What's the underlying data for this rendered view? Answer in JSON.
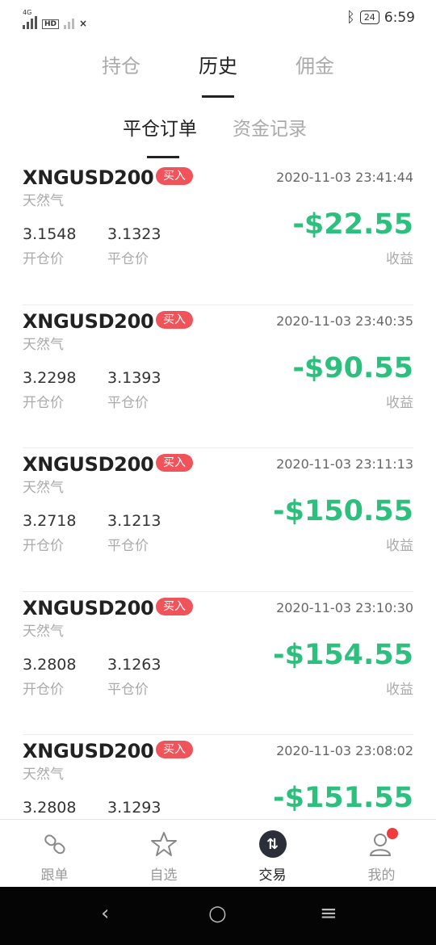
{
  "status_bar": {
    "network": "4G",
    "hd": "HD",
    "x": "×",
    "battery": "24",
    "time": "6:59"
  },
  "tabs": [
    {
      "label": "持仓"
    },
    {
      "label": "历史"
    },
    {
      "label": "佣金"
    }
  ],
  "subtabs": [
    {
      "label": "平仓订单"
    },
    {
      "label": "资金记录"
    }
  ],
  "labels": {
    "open_price": "开仓价",
    "close_price": "平仓价",
    "profit": "收益"
  },
  "orders": [
    {
      "symbol": "XNGUSD200",
      "side": "买入",
      "time": "2020-11-03 23:41:44",
      "name": "天然气",
      "open_price": "3.1548",
      "close_price": "3.1323",
      "pnl": "-$22.55"
    },
    {
      "symbol": "XNGUSD200",
      "side": "买入",
      "time": "2020-11-03 23:40:35",
      "name": "天然气",
      "open_price": "3.2298",
      "close_price": "3.1393",
      "pnl": "-$90.55"
    },
    {
      "symbol": "XNGUSD200",
      "side": "买入",
      "time": "2020-11-03 23:11:13",
      "name": "天然气",
      "open_price": "3.2718",
      "close_price": "3.1213",
      "pnl": "-$150.55"
    },
    {
      "symbol": "XNGUSD200",
      "side": "买入",
      "time": "2020-11-03 23:10:30",
      "name": "天然气",
      "open_price": "3.2808",
      "close_price": "3.1263",
      "pnl": "-$154.55"
    },
    {
      "symbol": "XNGUSD200",
      "side": "买入",
      "time": "2020-11-03 23:08:02",
      "name": "天然气",
      "open_price": "3.2808",
      "close_price": "3.1293",
      "pnl": "-$151.55"
    }
  ],
  "bottom_nav": [
    {
      "label": "跟单",
      "icon": "link-icon"
    },
    {
      "label": "自选",
      "icon": "star-icon"
    },
    {
      "label": "交易",
      "icon": "trade-icon"
    },
    {
      "label": "我的",
      "icon": "profile-icon"
    }
  ],
  "colors": {
    "pnl": "#2dbf7d",
    "badge": "#f0545a"
  }
}
